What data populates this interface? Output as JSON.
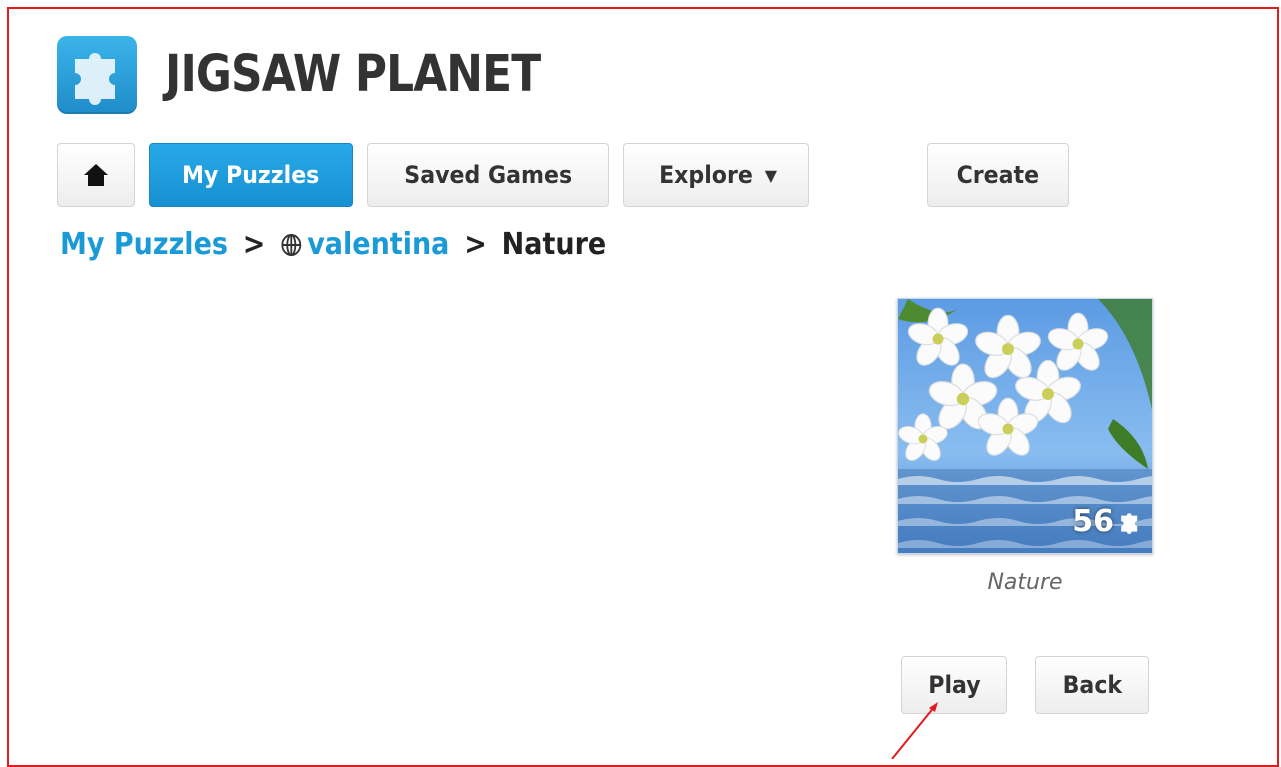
{
  "header": {
    "site_title": "JIGSAW PLANET",
    "logo_icon": "puzzle-piece-icon"
  },
  "nav": {
    "home_icon": "home-icon",
    "my_puzzles_label": "My Puzzles",
    "saved_games_label": "Saved Games",
    "explore_label": "Explore",
    "explore_caret": "▼",
    "create_label": "Create"
  },
  "breadcrumb": {
    "root": "My Puzzles",
    "sep1": ">",
    "user_icon": "globe-icon",
    "user": "valentina",
    "sep2": ">",
    "current": "Nature"
  },
  "puzzle": {
    "pieces": "56",
    "pieces_icon": "puzzle-piece-icon",
    "caption": "Nature"
  },
  "actions": {
    "play_label": "Play",
    "back_label": "Back"
  },
  "colors": {
    "accent": "#1a9ad6",
    "active_button": "#1f99db",
    "frame_border": "#e21b1b",
    "annotation_arrow": "#e21b1b"
  }
}
